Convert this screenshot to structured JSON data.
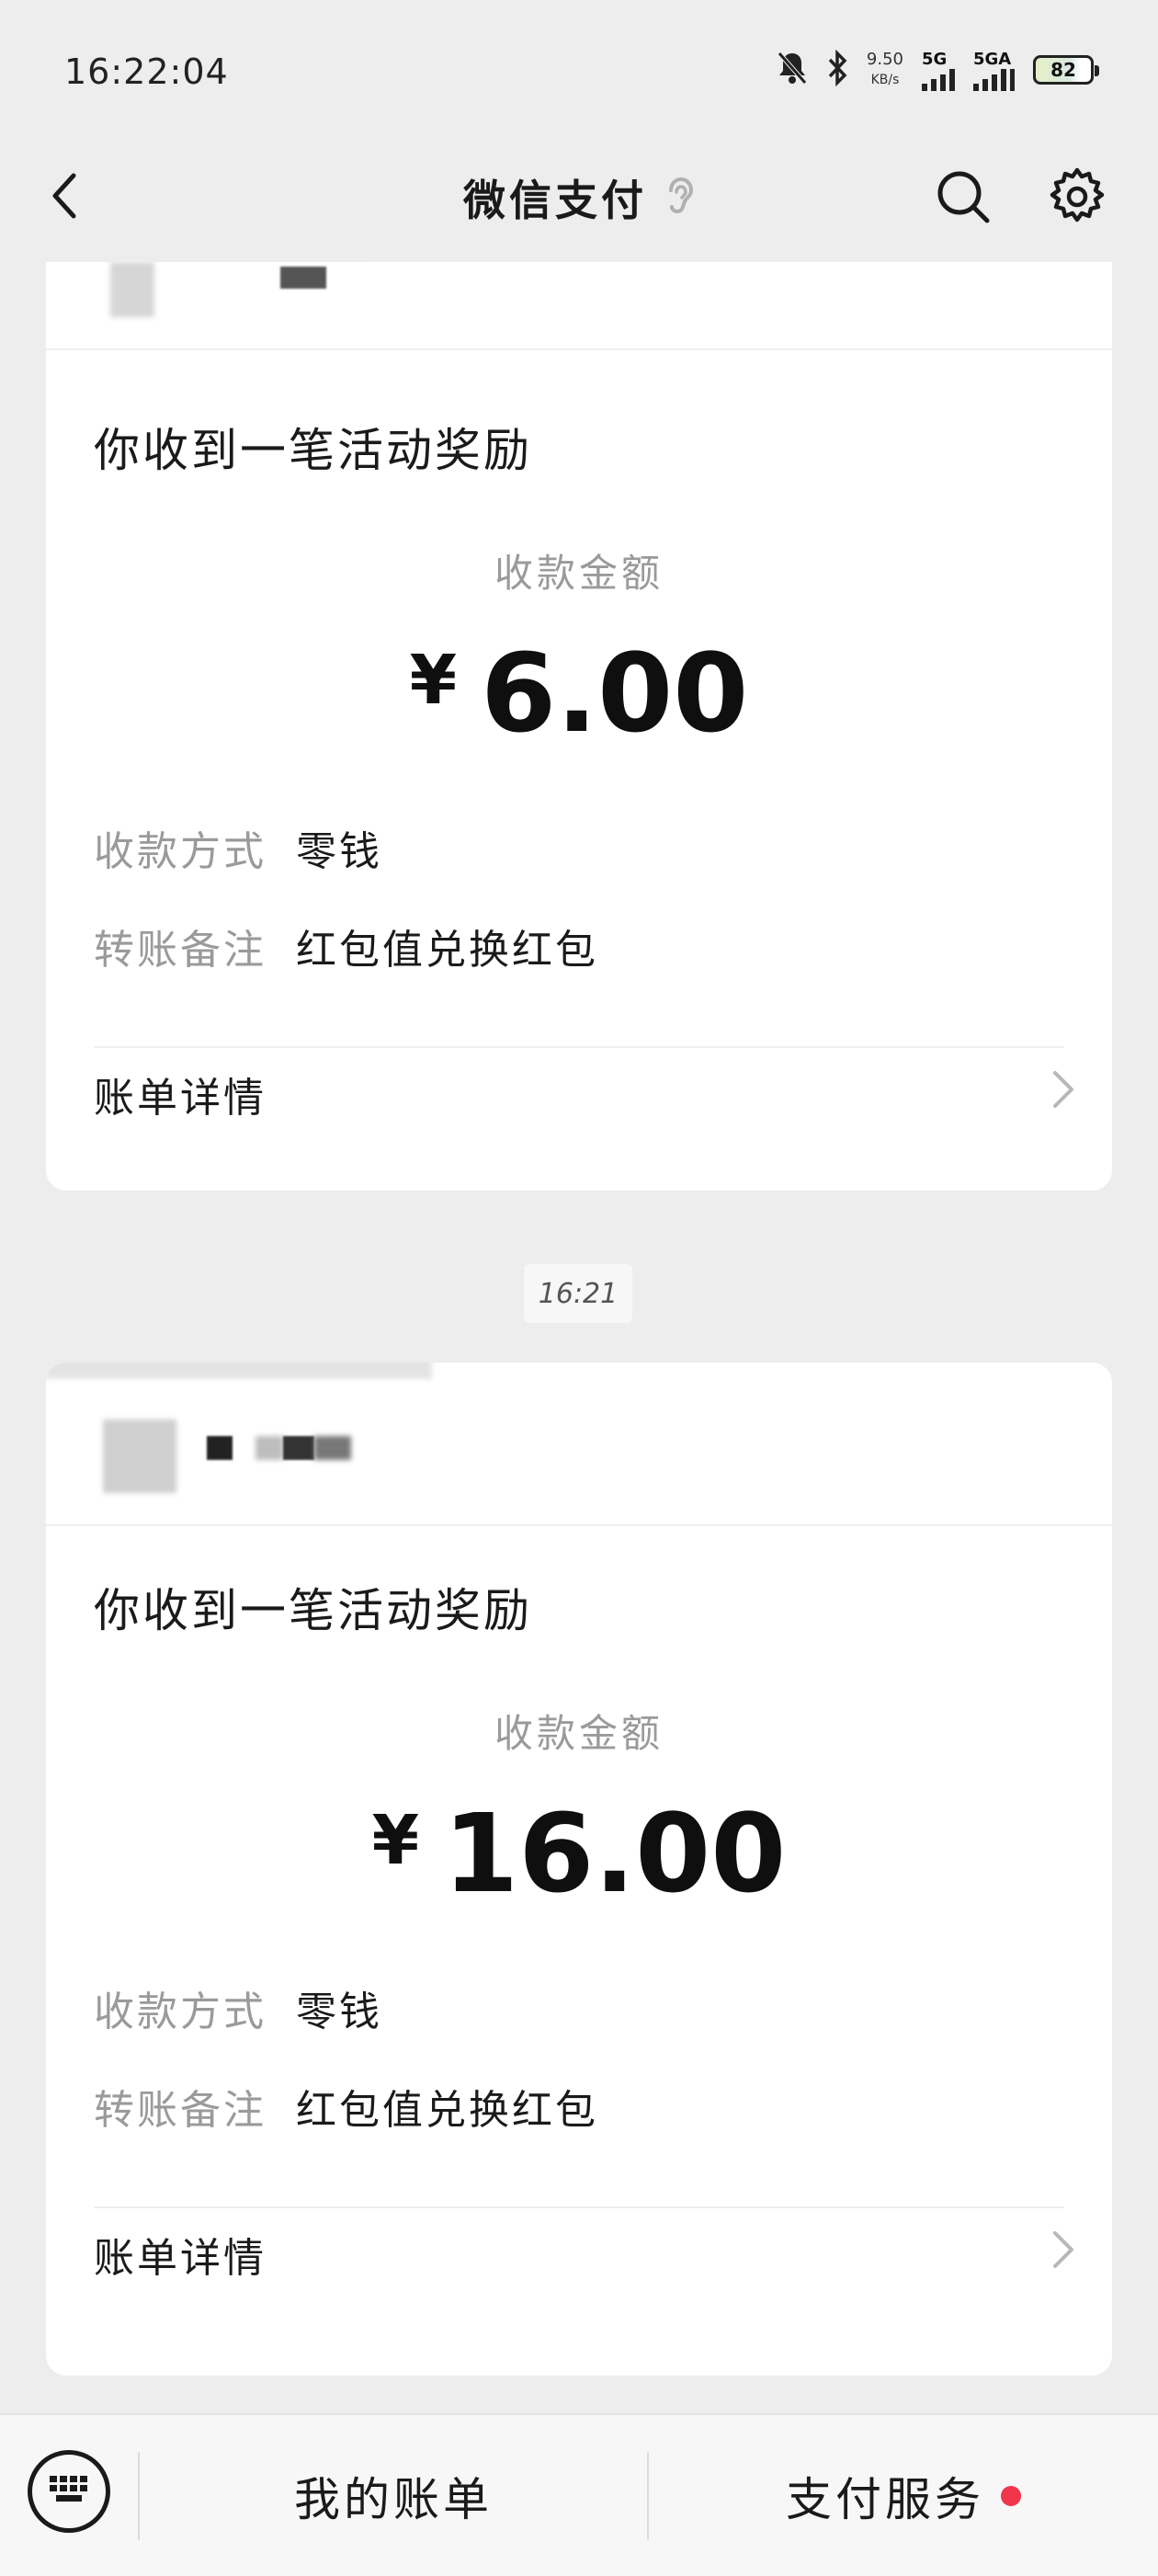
{
  "status_bar": {
    "time": "16:22:04",
    "net_speed": "9.50",
    "net_speed_unit": "KB/s",
    "signal1": "5G",
    "signal2": "5GA",
    "battery": "82",
    "icons": [
      "bell-off-icon",
      "bluetooth-icon"
    ]
  },
  "nav": {
    "title": "微信支付",
    "icons": [
      "back-icon",
      "ear-icon",
      "search-icon",
      "gear-icon"
    ]
  },
  "messages": [
    {
      "title": "你收到一笔活动奖励",
      "amount_label": "收款金额",
      "currency": "¥",
      "amount": "6.00",
      "method_label": "收款方式",
      "method_value": "零钱",
      "note_label": "转账备注",
      "note_value": "红包值兑换红包",
      "detail_label": "账单详情"
    },
    {
      "title": "你收到一笔活动奖励",
      "amount_label": "收款金额",
      "currency": "¥",
      "amount": "16.00",
      "method_label": "收款方式",
      "method_value": "零钱",
      "note_label": "转账备注",
      "note_value": "红包值兑换红包",
      "detail_label": "账单详情"
    }
  ],
  "timestamp": "16:21",
  "bottom_bar": {
    "tab1": "我的账单",
    "tab2": "支付服务",
    "accent_dot_color": "#f0344a"
  }
}
